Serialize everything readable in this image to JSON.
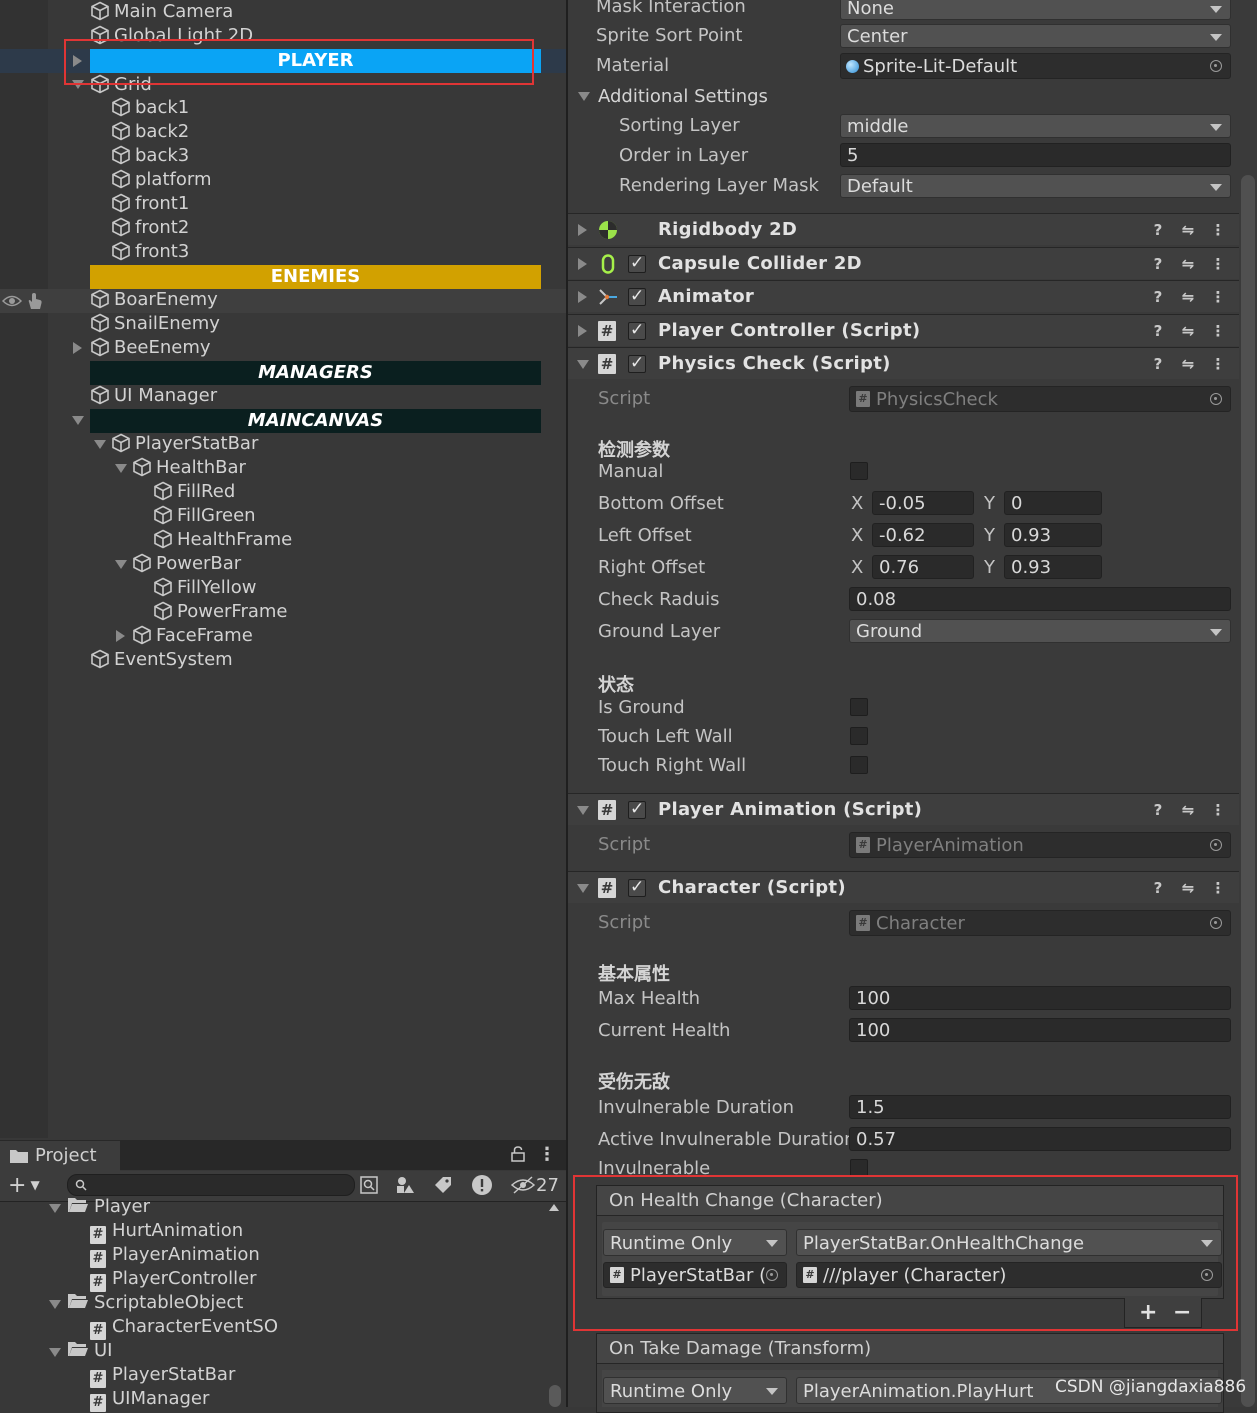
{
  "hierarchy": {
    "items": [
      {
        "label": "Main Camera"
      },
      {
        "label": "Global Light 2D"
      },
      {
        "label": "Grid"
      },
      {
        "label": "back1"
      },
      {
        "label": "back2"
      },
      {
        "label": "back3"
      },
      {
        "label": "platform"
      },
      {
        "label": "front1"
      },
      {
        "label": "front2"
      },
      {
        "label": "front3"
      },
      {
        "label": "BoarEnemy"
      },
      {
        "label": "SnailEnemy"
      },
      {
        "label": "BeeEnemy"
      },
      {
        "label": "UI Manager"
      },
      {
        "label": "PlayerStatBar"
      },
      {
        "label": "HealthBar"
      },
      {
        "label": "FillRed"
      },
      {
        "label": "FillGreen"
      },
      {
        "label": "HealthFrame"
      },
      {
        "label": "PowerBar"
      },
      {
        "label": "FillYellow"
      },
      {
        "label": "PowerFrame"
      },
      {
        "label": "FaceFrame"
      },
      {
        "label": "EventSystem"
      }
    ],
    "headers": {
      "player": {
        "label": "PLAYER",
        "color": "#0aa4f5",
        "text_color": "#ffffff"
      },
      "enemies": {
        "label": "ENEMIES",
        "color": "#d2a100",
        "text_color": "#ffffff"
      },
      "managers": {
        "label": "MANAGERS",
        "color": "#0a1f1f",
        "text_color": "#ffffff"
      },
      "maincanvas": {
        "label": "MAINCANVAS",
        "color": "#0a1f1f",
        "text_color": "#ffffff"
      }
    }
  },
  "project": {
    "tab_label": "Project",
    "hidden_count": "27",
    "items": [
      {
        "label": "Player",
        "kind": "folder"
      },
      {
        "label": "HurtAnimation",
        "kind": "script"
      },
      {
        "label": "PlayerAnimation",
        "kind": "script"
      },
      {
        "label": "PlayerController",
        "kind": "script"
      },
      {
        "label": "ScriptableObject",
        "kind": "folder"
      },
      {
        "label": "CharacterEventSO",
        "kind": "script"
      },
      {
        "label": "UI",
        "kind": "folder"
      },
      {
        "label": "PlayerStatBar",
        "kind": "script"
      },
      {
        "label": "UIManager",
        "kind": "script"
      }
    ]
  },
  "inspector": {
    "sprite_renderer": {
      "mask_interaction": {
        "label": "Mask Interaction",
        "value": "None"
      },
      "sprite_sort_point": {
        "label": "Sprite Sort Point",
        "value": "Center"
      },
      "material": {
        "label": "Material",
        "value": "Sprite-Lit-Default"
      },
      "additional_settings": "Additional Settings",
      "sorting_layer": {
        "label": "Sorting Layer",
        "value": "middle"
      },
      "order_in_layer": {
        "label": "Order in Layer",
        "value": "5"
      },
      "rendering_layer_mask": {
        "label": "Rendering Layer Mask",
        "value": "Default"
      }
    },
    "components": [
      {
        "title": "Rigidbody 2D"
      },
      {
        "title": "Capsule Collider 2D"
      },
      {
        "title": "Animator"
      },
      {
        "title": "Player Controller (Script)"
      },
      {
        "title": "Physics Check (Script)"
      },
      {
        "title": "Player Animation (Script)"
      },
      {
        "title": "Character (Script)"
      }
    ],
    "physics_check": {
      "script_label": "Script",
      "script_value": "PhysicsCheck",
      "section_params": "检测参数",
      "manual": "Manual",
      "bottom_offset": {
        "label": "Bottom Offset",
        "x": "-0.05",
        "y": "0"
      },
      "left_offset": {
        "label": "Left Offset",
        "x": "-0.62",
        "y": "0.93"
      },
      "right_offset": {
        "label": "Right Offset",
        "x": "0.76",
        "y": "0.93"
      },
      "check_radius": {
        "label": "Check Raduis",
        "value": "0.08"
      },
      "ground_layer": {
        "label": "Ground Layer",
        "value": "Ground"
      },
      "section_state": "状态",
      "is_ground": "Is Ground",
      "touch_left_wall": "Touch Left Wall",
      "touch_right_wall": "Touch Right Wall",
      "x_label": "X",
      "y_label": "Y"
    },
    "player_animation": {
      "script_label": "Script",
      "script_value": "PlayerAnimation"
    },
    "character": {
      "script_label": "Script",
      "script_value": "Character",
      "section_basic": "基本属性",
      "max_health": {
        "label": "Max Health",
        "value": "100"
      },
      "current_health": {
        "label": "Current Health",
        "value": "100"
      },
      "section_invuln": "受伤无敌",
      "invulnerable_duration": {
        "label": "Invulnerable Duration",
        "value": "1.5"
      },
      "active_invulnerable_duration": {
        "label": "Active Invulnerable Duration",
        "value": "0.57"
      },
      "invulnerable": "Invulnerable"
    },
    "events": {
      "on_health_change": {
        "title": "On Health Change (Character)",
        "mode": "Runtime Only",
        "function": "PlayerStatBar.OnHealthChange",
        "target": "PlayerStatBar (",
        "argument": "///player (Character)",
        "add": "+",
        "remove": "−"
      },
      "on_take_damage": {
        "title": "On Take Damage (Transform)",
        "mode": "Runtime Only",
        "function": "PlayerAnimation.PlayHurt"
      }
    }
  },
  "watermark": "CSDN @jiangdaxia886",
  "colors": {
    "highlight_red": "#e03535",
    "rigidbody_icon": "#9be24a",
    "collider_icon": "#a6f04a"
  }
}
